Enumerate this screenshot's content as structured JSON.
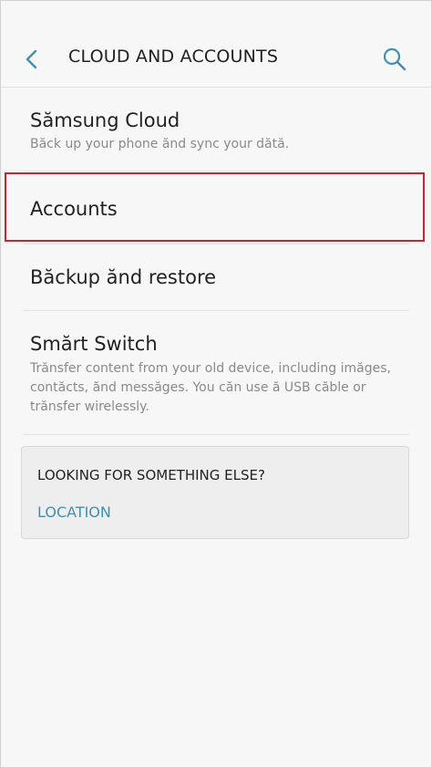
{
  "header": {
    "title": "CLOUD AND ACCOUNTS"
  },
  "items": [
    {
      "title": "Sămsung Cloud",
      "description": "Băck up your phone ănd sync your dătă."
    },
    {
      "title": "Accounts",
      "description": ""
    },
    {
      "title": "Băckup ănd restore",
      "description": ""
    },
    {
      "title": "Smărt Switch",
      "description": "Trănsfer content from your old device, including imăges, contăcts, ănd messăges. You căn use ă USB căble or trănsfer wirelessly."
    }
  ],
  "card": {
    "title": "LOOKING FOR SOMETHING ELSE?",
    "link": "LOCATION"
  },
  "colors": {
    "accent": "#3f91b1",
    "highlight": "#d2212c",
    "background": "#f7f7f7"
  },
  "icons": {
    "back": "back-arrow-icon",
    "search": "search-icon"
  }
}
